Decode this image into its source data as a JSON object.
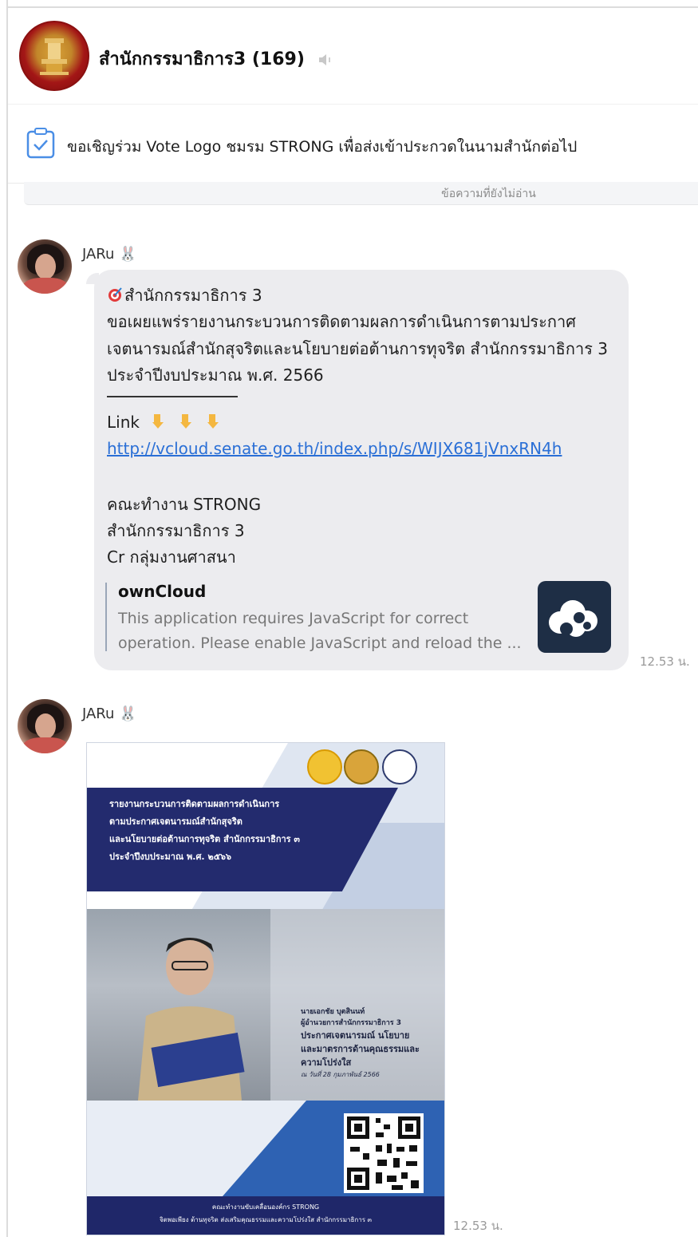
{
  "header": {
    "group_name": "สำนักกรรมาธิการ3",
    "member_count": "(169)",
    "mute_icon": "speaker-muted-icon"
  },
  "announcement": {
    "icon": "checkbox-clipboard-icon",
    "text": "ขอเชิญร่วม Vote Logo ชมรม STRONG เพื่อส่งเข้าประกวดในนามสำนักต่อไป"
  },
  "unread_divider": "ข้อความที่ยังไม่อ่าน",
  "messages": [
    {
      "sender": "JARu 🐰",
      "lines": {
        "l1": "สำนักกรรมาธิการ 3",
        "l2": "ขอเผยแพร่รายงานกระบวนการติดตามผลการดำเนินการตามประกาศ",
        "l3": "เจตนารมณ์สำนักสุจริตและนโยบายต่อต้านการทุจริต สำนักกรรมาธิการ 3",
        "l4": "ประจำปีงบประมาณ  พ.ศ. 2566",
        "l5": "Link",
        "link": "http://vcloud.senate.go.th/index.php/s/WIJX681jVnxRN4h",
        "l6": "คณะทำงาน STRONG",
        "l7": "สำนักกรรมาธิการ 3",
        "l8": "Cr กลุ่มงานศาสนา"
      },
      "preview": {
        "title": "ownCloud",
        "desc1": "This application requires JavaScript for correct",
        "desc2": "operation. Please enable JavaScript and reload the ...",
        "thumb_icon": "owncloud-logo-icon"
      },
      "time": "12.53 น."
    },
    {
      "sender": "JARu 🐰",
      "poster": {
        "title_lines": [
          "รายงานกระบวนการติดตามผลการดำเนินการ",
          "ตามประกาศเจตนารมณ์สำนักสุจริต",
          "และนโยบายต่อต้านการทุจริต สำนักกรรมาธิการ ๓",
          "ประจำปีงบประมาณ พ.ศ. ๒๕๖๖"
        ],
        "caption_name": "นายเอกชัย  บุตสินนท์",
        "caption_role": "ผู้อำนวยการสำนักกรรมาธิการ 3",
        "caption_big1": "ประกาศเจตนารมณ์ นโยบาย",
        "caption_big2": "และมาตรการด้านคุณธรรมและ",
        "caption_big3": "ความโปร่งใส",
        "caption_date": "ณ วันที่ 28 กุมภาพันธ์ 2566",
        "footer1": "คณะทำงานขับเคลื่อนองค์กร STRONG",
        "footer2": "จิตพอเพียง ต้านทุจริต ส่งเสริมคุณธรรมและความโปร่งใส สำนักกรรมาธิการ ๓"
      },
      "time": "12.53 น."
    }
  ]
}
